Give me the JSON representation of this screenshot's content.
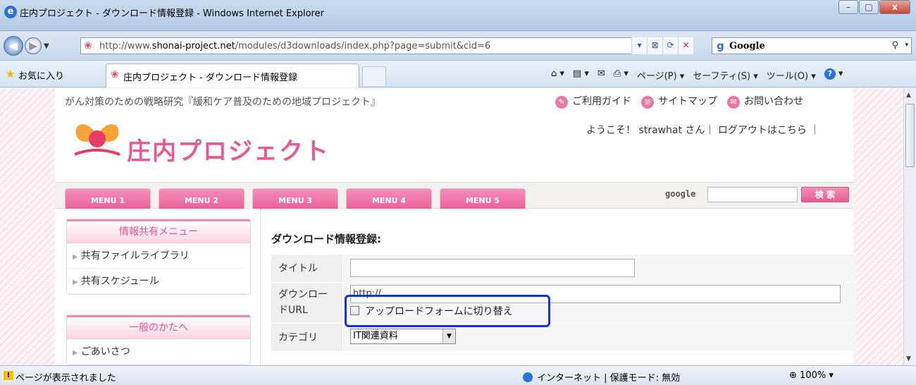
{
  "window": {
    "title": "庄内プロジェクト - ダウンロード情報登録 - Windows Internet Explorer",
    "min": "–",
    "max": "□",
    "close": "x"
  },
  "address": {
    "url_prefix": "http://www.",
    "url_domain": "shonai-project.net",
    "url_path": "/modules/d3downloads/index.php?page=submit&cid=6",
    "search_engine": "Google"
  },
  "favorites": {
    "label": "お気に入り",
    "tab_title": "庄内プロジェクト - ダウンロード情報登録"
  },
  "commandbar": {
    "page": "ページ(P) ▾",
    "safety": "セーフティ(S) ▾",
    "tools": "ツール(O) ▾"
  },
  "site": {
    "tagline": "がん対策のための戦略研究『緩和ケア普及のための地域プロジェクト』",
    "logo_text": "庄内プロジェクト",
    "links": [
      "ご利用ガイド",
      "サイトマップ",
      "お問い合わせ"
    ],
    "welcome": "ようこそ！ strawhat さん｜ ログアウトはこちら ｜"
  },
  "menu": {
    "tabs": [
      "MENU 1",
      "MENU 2",
      "MENU 3",
      "MENU 4",
      "MENU 5"
    ],
    "google_label": "google",
    "search_button": "検 索"
  },
  "sidebar": {
    "box1_title": "情報共有メニュー",
    "box1_items": [
      "共有ファイルライブラリ",
      "共有スケジュール"
    ],
    "box2_title": "一般のかたへ",
    "box2_items": [
      "ごあいさつ"
    ]
  },
  "content": {
    "title": "ダウンロード情報登録:",
    "title_label": "タイトル",
    "url_label_1": "ダウンロー",
    "url_label_2": "ドURL",
    "url_value": "http://",
    "upload_toggle": "アップロードフォームに切り替え",
    "category_label": "カテゴリ",
    "category_value": "IT関連資料"
  },
  "status": {
    "text": "ページが表示されました",
    "zone": "インターネット | 保護モード: 無効",
    "zoom": "100%"
  }
}
